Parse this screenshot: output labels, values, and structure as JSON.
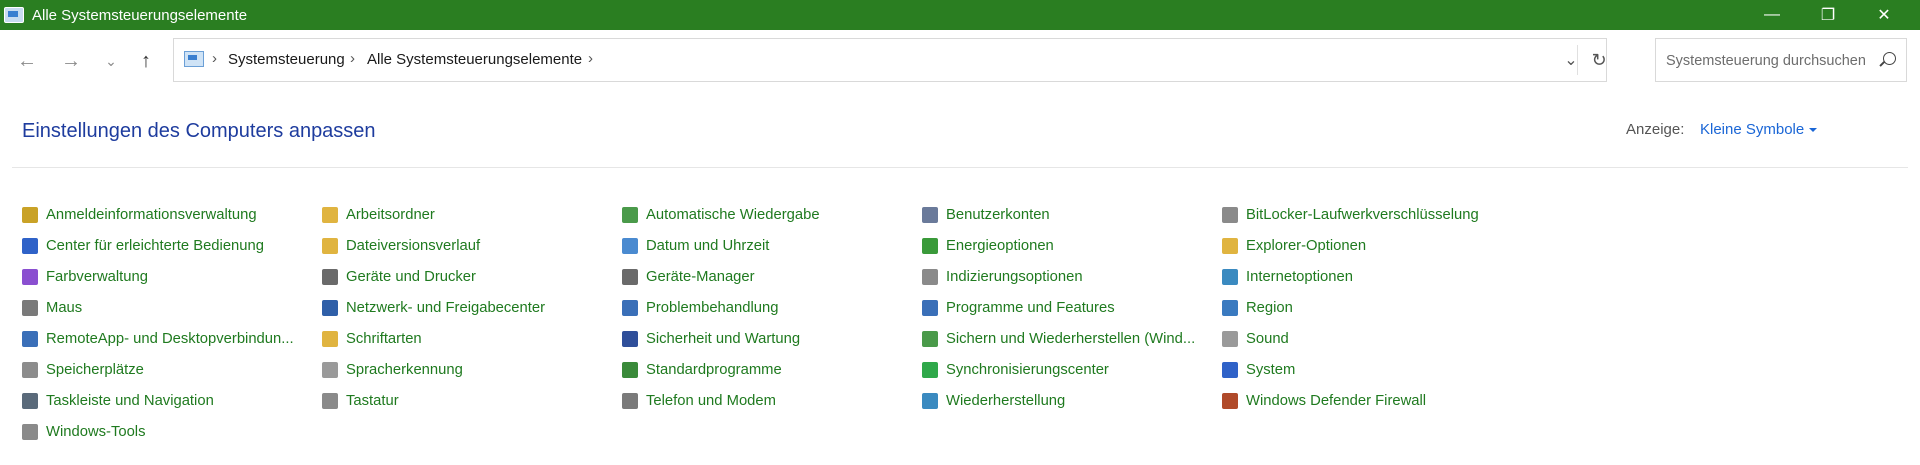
{
  "window": {
    "title": "Alle Systemsteuerungselemente"
  },
  "address": {
    "crumbs": [
      "Systemsteuerung",
      "Alle Systemsteuerungselemente"
    ]
  },
  "search": {
    "placeholder": "Systemsteuerung durchsuchen"
  },
  "header": {
    "title": "Einstellungen des Computers anpassen",
    "view_label": "Anzeige:",
    "view_value": "Kleine Symbole"
  },
  "items": [
    {
      "label": "Anmeldeinformationsverwaltung",
      "icon": "credential-manager-icon",
      "color": "#c9a227"
    },
    {
      "label": "Center für erleichterte Bedienung",
      "icon": "ease-of-access-icon",
      "color": "#2f62c8"
    },
    {
      "label": "Farbverwaltung",
      "icon": "color-management-icon",
      "color": "#8a4fd0"
    },
    {
      "label": "Maus",
      "icon": "mouse-icon",
      "color": "#7a7a7a"
    },
    {
      "label": "RemoteApp- und Desktopverbindun...",
      "icon": "remoteapp-icon",
      "color": "#3a6fb8"
    },
    {
      "label": "Speicherplätze",
      "icon": "storage-spaces-icon",
      "color": "#8c8c8c"
    },
    {
      "label": "Taskleiste und Navigation",
      "icon": "taskbar-icon",
      "color": "#5a6a7a"
    },
    {
      "label": "Windows-Tools",
      "icon": "windows-tools-icon",
      "color": "#8a8a8a"
    },
    {
      "label": "Arbeitsordner",
      "icon": "work-folders-icon",
      "color": "#e0b440"
    },
    {
      "label": "Dateiversionsverlauf",
      "icon": "file-history-icon",
      "color": "#e0b440"
    },
    {
      "label": "Geräte und Drucker",
      "icon": "devices-printers-icon",
      "color": "#6a6a6a"
    },
    {
      "label": "Netzwerk- und Freigabecenter",
      "icon": "network-center-icon",
      "color": "#2f5fa8"
    },
    {
      "label": "Schriftarten",
      "icon": "fonts-icon",
      "color": "#e0b440"
    },
    {
      "label": "Spracherkennung",
      "icon": "speech-recognition-icon",
      "color": "#9a9a9a"
    },
    {
      "label": "Tastatur",
      "icon": "keyboard-icon",
      "color": "#8a8a8a"
    },
    {
      "label": "Automatische Wiedergabe",
      "icon": "autoplay-icon",
      "color": "#4a9a4a"
    },
    {
      "label": "Datum und Uhrzeit",
      "icon": "date-time-icon",
      "color": "#4a8ad0"
    },
    {
      "label": "Geräte-Manager",
      "icon": "device-manager-icon",
      "color": "#6a6a6a"
    },
    {
      "label": "Problembehandlung",
      "icon": "troubleshooting-icon",
      "color": "#3a6fb8"
    },
    {
      "label": "Sicherheit und Wartung",
      "icon": "security-maintenance-icon",
      "color": "#2f4f9a"
    },
    {
      "label": "Standardprogramme",
      "icon": "default-programs-icon",
      "color": "#3a8a3a"
    },
    {
      "label": "Telefon und Modem",
      "icon": "phone-modem-icon",
      "color": "#7a7a7a"
    },
    {
      "label": "Benutzerkonten",
      "icon": "user-accounts-icon",
      "color": "#6a7a9a"
    },
    {
      "label": "Energieoptionen",
      "icon": "power-options-icon",
      "color": "#3a9a3a"
    },
    {
      "label": "Indizierungsoptionen",
      "icon": "indexing-options-icon",
      "color": "#8a8a8a"
    },
    {
      "label": "Programme und Features",
      "icon": "programs-features-icon",
      "color": "#3a6fb8"
    },
    {
      "label": "Sichern und Wiederherstellen (Wind...",
      "icon": "backup-restore-icon",
      "color": "#4a9a4a"
    },
    {
      "label": "Synchronisierungscenter",
      "icon": "sync-center-icon",
      "color": "#2fa84a"
    },
    {
      "label": "Wiederherstellung",
      "icon": "recovery-icon",
      "color": "#3a8ac0"
    },
    {
      "label": "BitLocker-Laufwerkverschlüsselung",
      "icon": "bitlocker-icon",
      "color": "#8a8a8a"
    },
    {
      "label": "Explorer-Optionen",
      "icon": "explorer-options-icon",
      "color": "#e0b440"
    },
    {
      "label": "Internetoptionen",
      "icon": "internet-options-icon",
      "color": "#3a8ac0"
    },
    {
      "label": "Region",
      "icon": "region-icon",
      "color": "#3a7ac0"
    },
    {
      "label": "Sound",
      "icon": "sound-icon",
      "color": "#9a9a9a"
    },
    {
      "label": "System",
      "icon": "system-icon",
      "color": "#2f62c8"
    },
    {
      "label": "Windows Defender Firewall",
      "icon": "firewall-icon",
      "color": "#b04a2a"
    }
  ]
}
